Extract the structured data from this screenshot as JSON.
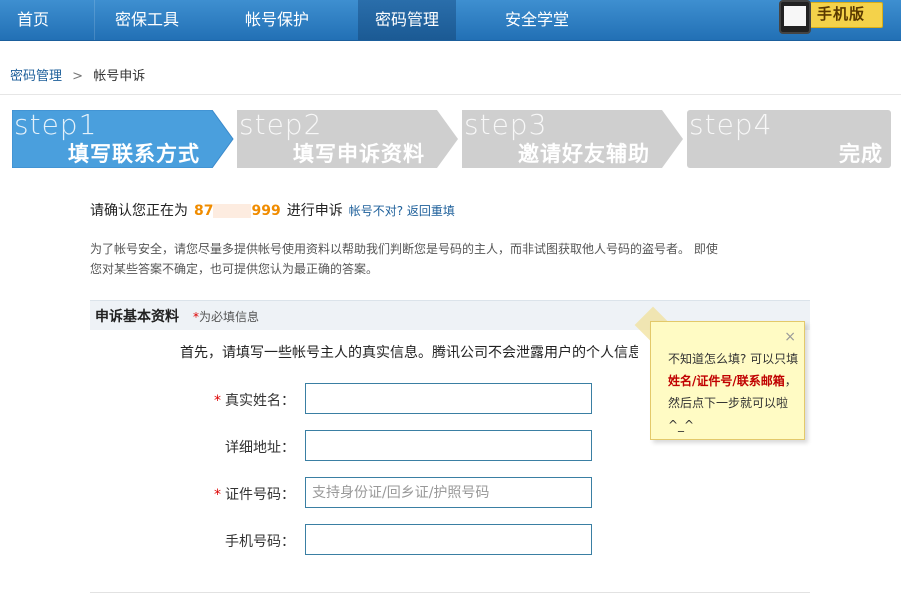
{
  "nav": {
    "items": [
      "首页",
      "密保工具",
      "帐号保护",
      "密码管理",
      "安全学堂"
    ],
    "active_index": 3,
    "mobile_label": "手机版"
  },
  "breadcrumb": {
    "parent": "密码管理",
    "separator": ">",
    "current": "帐号申诉"
  },
  "steps": [
    {
      "num": "step1",
      "title": "填写联系方式",
      "state": "active"
    },
    {
      "num": "step2",
      "title": "填写申诉资料",
      "state": "inactive"
    },
    {
      "num": "step3",
      "title": "邀请好友辅助",
      "state": "inactive"
    },
    {
      "num": "step4",
      "title": "完成",
      "state": "inactive"
    }
  ],
  "confirm": {
    "prefix": "请确认您正在为",
    "account_head": "87",
    "account_tail": "999",
    "suffix": "进行申诉",
    "wrong_account_link": "帐号不对? 返回重填"
  },
  "notice": "为了帐号安全，请您尽量多提供帐号使用资料以帮助我们判断您是号码的主人，而非试图获取他人号码的盗号者。 即使您对某些答案不确定，也可提供您认为最正确的答案。",
  "section": {
    "title": "申诉基本资料",
    "required_star": "*",
    "required_note": "为必填信息",
    "intro": "首先，请填写一些帐号主人的真实信息。腾讯公司不会泄露用户的个人信息"
  },
  "form": {
    "fields": [
      {
        "label": "真实姓名：",
        "required": true,
        "value": "",
        "placeholder": ""
      },
      {
        "label": "详细地址：",
        "required": false,
        "value": "",
        "placeholder": ""
      },
      {
        "label": "证件号码：",
        "required": true,
        "value": "",
        "placeholder": "支持身份证/回乡证/护照号码"
      },
      {
        "label": "手机号码：",
        "required": false,
        "value": "",
        "placeholder": ""
      }
    ]
  },
  "tooltip": {
    "close": "×",
    "line1": "不知道怎么填? 可以只填",
    "highlight": "姓名/证件号/联系邮箱",
    "line2": "，然后点下一步就可以啦^_^"
  },
  "colors": {
    "nav_bg": "#2a7cc2",
    "step_active": "#4a9fdd",
    "step_inactive": "#cfcfcf",
    "account": "#f08c00",
    "link": "#1d5f9a",
    "required": "#dd0000"
  }
}
